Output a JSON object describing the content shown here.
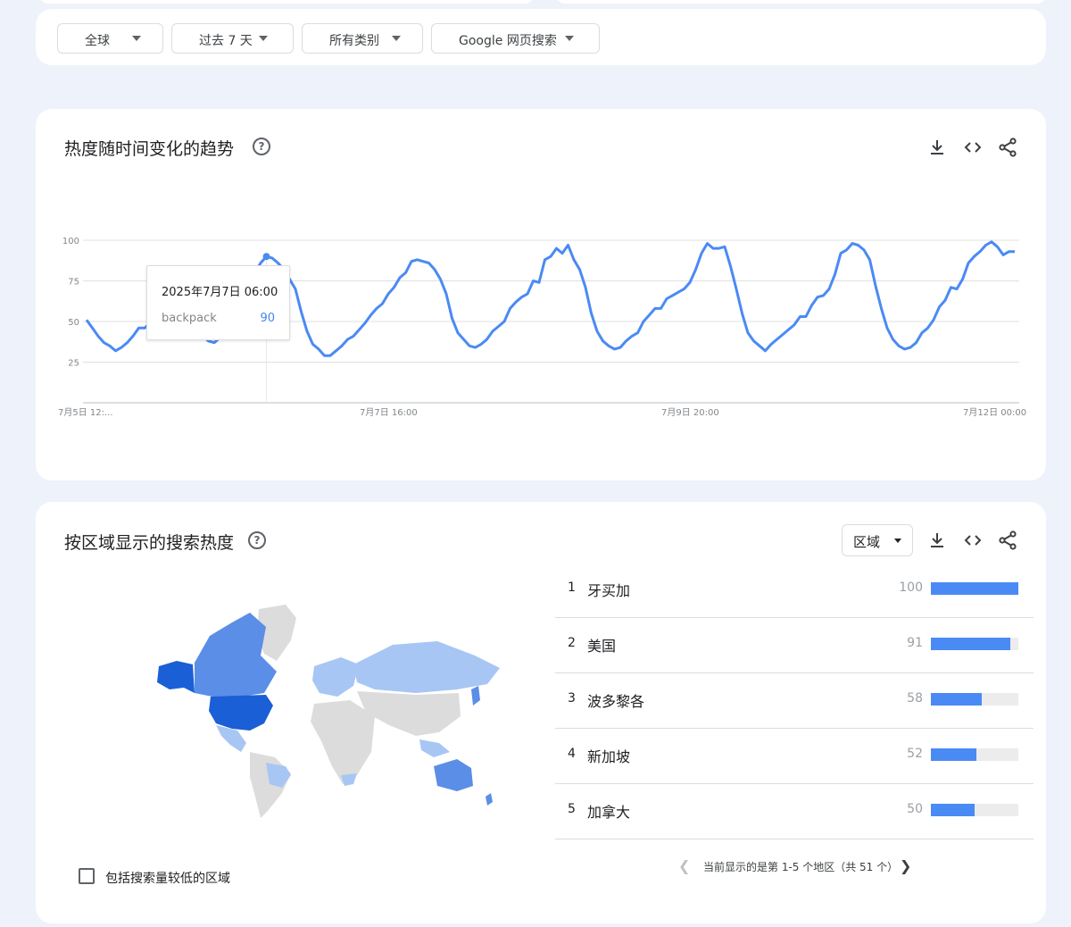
{
  "filters": {
    "region": "全球",
    "time": "过去 7 天",
    "category": "所有类别",
    "search_type": "Google 网页搜索"
  },
  "trend": {
    "title": "热度随时间变化的趋势",
    "tooltip": {
      "date": "2025年7月7日 06:00",
      "term": "backpack",
      "value": "90"
    }
  },
  "chart_data": {
    "type": "line",
    "title": "",
    "xlabel": "",
    "ylabel": "",
    "ylim": [
      0,
      100
    ],
    "y_ticks": [
      "100",
      "75",
      "50",
      "25"
    ],
    "x_ticks": [
      "7月5日 12:...",
      "7月7日 16:00",
      "7月9日 20:00",
      "7月12日 00:00"
    ],
    "x_tick_index": [
      0,
      52,
      104,
      156
    ],
    "grid": true,
    "line_color": "#4a8af4",
    "series": [
      {
        "values": [
          51,
          46,
          41,
          37,
          35,
          32,
          34,
          37,
          41,
          46,
          46,
          49,
          54,
          58,
          62,
          64,
          64,
          60,
          54,
          47,
          41,
          38,
          37,
          40,
          46,
          56,
          63,
          70,
          73,
          80,
          86,
          90,
          89,
          86,
          82,
          76,
          70,
          56,
          44,
          36,
          33,
          29,
          29,
          32,
          35,
          39,
          41,
          45,
          49,
          54,
          58,
          61,
          67,
          71,
          77,
          80,
          87,
          88,
          87,
          86,
          82,
          76,
          67,
          52,
          43,
          39,
          35,
          34,
          36,
          39,
          44,
          47,
          50,
          58,
          62,
          65,
          67,
          75,
          74,
          88,
          90,
          95,
          92,
          97,
          88,
          82,
          71,
          55,
          44,
          38,
          35,
          33,
          34,
          38,
          41,
          43,
          50,
          54,
          58,
          58,
          64,
          66,
          68,
          70,
          74,
          82,
          92,
          98,
          95,
          95,
          96,
          84,
          70,
          55,
          43,
          38,
          35,
          32,
          36,
          39,
          42,
          45,
          48,
          53,
          53,
          60,
          65,
          66,
          70,
          79,
          92,
          94,
          98,
          97,
          94,
          88,
          72,
          58,
          46,
          39,
          35,
          33,
          34,
          37,
          43,
          46,
          51,
          59,
          63,
          71,
          70,
          76,
          86,
          90,
          93,
          97,
          99,
          96,
          91,
          93,
          93
        ]
      }
    ]
  },
  "region": {
    "title": "按区域显示的搜索热度",
    "dropdown": "区域",
    "rows": [
      {
        "rank": "1",
        "name": "牙买加",
        "value": "100",
        "bar": 100
      },
      {
        "rank": "2",
        "name": "美国",
        "value": "91",
        "bar": 91
      },
      {
        "rank": "3",
        "name": "波多黎各",
        "value": "58",
        "bar": 58
      },
      {
        "rank": "4",
        "name": "新加坡",
        "value": "52",
        "bar": 52
      },
      {
        "rank": "5",
        "name": "加拿大",
        "value": "50",
        "bar": 50
      }
    ],
    "pager_text": "当前显示的是第 1-5 个地区（共 51 个）",
    "checkbox_label": "包括搜索量较低的区域"
  },
  "colors": {
    "accent": "#4a8af4",
    "map_dark": "#1a5fd6",
    "map_mid": "#5b8ee6",
    "map_light": "#a7c6f4",
    "map_none": "#dcdcdc"
  }
}
